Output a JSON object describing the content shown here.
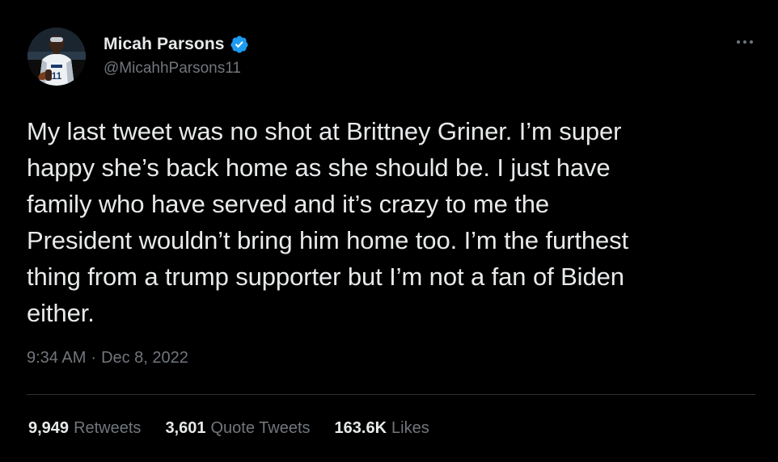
{
  "tweet": {
    "author": {
      "display_name": "Micah Parsons",
      "handle": "@MicahhParsons11",
      "verified": true,
      "verified_color": "#1d9bf0"
    },
    "more_icon": "more-horizontal-icon",
    "text": "My last tweet was no shot at Brittney Griner. I’m super\nhappy she’s back home as she should be. I just have\nfamily who have served and it’s crazy to me the\nPresident wouldn’t bring him home too. I’m the furthest\nthing from a trump supporter but I’m not a fan of Biden\neither.",
    "time": "9:34 AM",
    "separator": "·",
    "date": "Dec 8, 2022",
    "stats": {
      "retweets": {
        "count": "9,949",
        "label": "Retweets"
      },
      "quote_tweets": {
        "count": "3,601",
        "label": "Quote Tweets"
      },
      "likes": {
        "count": "163.6K",
        "label": "Likes"
      }
    }
  },
  "colors": {
    "background": "#000000",
    "primary_text": "#e7e9ea",
    "secondary_text": "#71767b",
    "divider": "#2f3336"
  }
}
